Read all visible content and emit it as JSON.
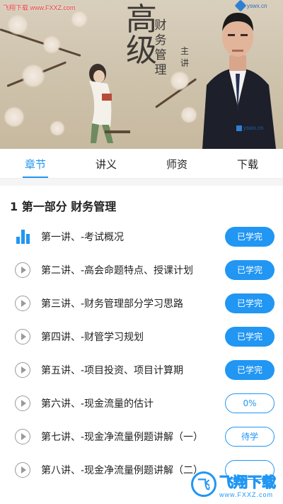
{
  "video": {
    "title_big": "高级",
    "title_sub": "财务管理",
    "side_text": "主讲",
    "watermark_top": "飞翔下载 www.FXXZ.com",
    "logo_text": "yswx.cn",
    "presenter_logo": "yswx.cn"
  },
  "tabs": [
    {
      "label": "章节",
      "active": true
    },
    {
      "label": "讲义",
      "active": false
    },
    {
      "label": "师资",
      "active": false
    },
    {
      "label": "下载",
      "active": false
    }
  ],
  "section": {
    "title": "1 第一部分 财务管理"
  },
  "lessons": [
    {
      "title": "第一讲、-考试概况",
      "status": "已学完",
      "state": "done",
      "icon": "playing-bars-icon"
    },
    {
      "title": "第二讲、-高会命题特点、授课计划",
      "status": "已学完",
      "state": "done",
      "icon": "play-icon"
    },
    {
      "title": "第三讲、-财务管理部分学习思路",
      "status": "已学完",
      "state": "done",
      "icon": "play-icon"
    },
    {
      "title": "第四讲、-财管学习规划",
      "status": "已学完",
      "state": "done",
      "icon": "play-icon"
    },
    {
      "title": "第五讲、-项目投资、项目计算期",
      "status": "已学完",
      "state": "done",
      "icon": "play-icon"
    },
    {
      "title": "第六讲、-现金流量的估计",
      "status": "0%",
      "state": "outline",
      "icon": "play-icon"
    },
    {
      "title": "第七讲、-现金净流量例题讲解（一）",
      "status": "待学",
      "state": "outline",
      "icon": "play-icon"
    },
    {
      "title": "第八讲、-现金净流量例题讲解（二）",
      "status": "",
      "state": "outline",
      "icon": "play-icon"
    }
  ],
  "watermark_bottom": {
    "badge": "飞",
    "main": "飞翔下载",
    "url": "www.FXXZ.com"
  },
  "colors": {
    "accent": "#2196f3",
    "icon_gray": "#9a9a9a"
  }
}
